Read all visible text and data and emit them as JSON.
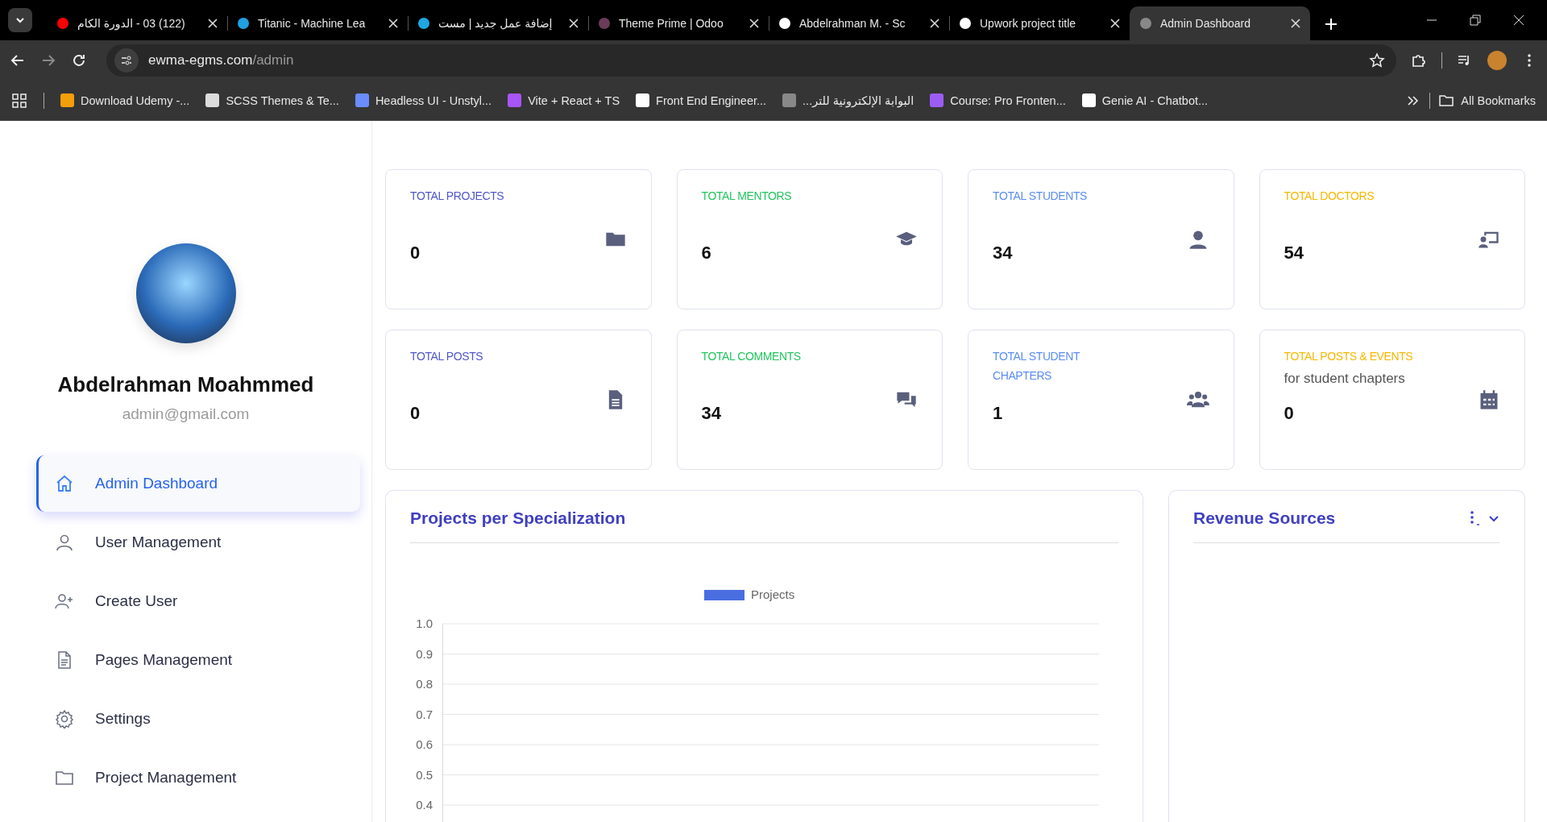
{
  "browser": {
    "tabs": [
      {
        "title": "(122) 03 - الدورة الكام",
        "selected": false
      },
      {
        "title": "Titanic - Machine Lea",
        "selected": false
      },
      {
        "title": "إضافة عمل جديد | مست",
        "selected": false
      },
      {
        "title": "Theme Prime | Odoo",
        "selected": false
      },
      {
        "title": "Abdelrahman M. - Sc",
        "selected": false
      },
      {
        "title": "Upwork project title",
        "selected": false
      },
      {
        "title": "Admin Dashboard",
        "selected": true
      }
    ],
    "url": {
      "host": "ewma-egms.com",
      "path": "/admin"
    },
    "bookmarks": [
      "Download Udemy -...",
      "SCSS Themes & Te...",
      "Headless UI - Unstyl...",
      "Vite + React + TS",
      "Front End Engineer...",
      "البوابة الإلكترونية للتر...",
      "Course: Pro Fronten...",
      "Genie AI - Chatbot..."
    ],
    "all_bookmarks": "All Bookmarks"
  },
  "profile": {
    "name": "Abdelrahman Moahmmed",
    "email": "admin@gmail.com"
  },
  "sidebar": {
    "items": [
      {
        "label": "Admin Dashboard",
        "selected": true
      },
      {
        "label": "User Management",
        "selected": false
      },
      {
        "label": "Create User",
        "selected": false
      },
      {
        "label": "Pages Management",
        "selected": false
      },
      {
        "label": "Settings",
        "selected": false
      },
      {
        "label": "Project Management",
        "selected": false
      }
    ]
  },
  "stats": [
    {
      "label": "TOTAL PROJECTS",
      "value": "0",
      "color": "#4f57c9"
    },
    {
      "label": "TOTAL MENTORS",
      "value": "6",
      "color": "#22c55e"
    },
    {
      "label": "TOTAL STUDENTS",
      "value": "34",
      "color": "#5b8def"
    },
    {
      "label": "TOTAL DOCTORS",
      "value": "54",
      "color": "#f5b800"
    },
    {
      "label": "TOTAL POSTS",
      "value": "0",
      "color": "#4f57c9"
    },
    {
      "label": "TOTAL COMMENTS",
      "value": "34",
      "color": "#22c55e"
    },
    {
      "label": "TOTAL STUDENT CHAPTERS",
      "value": "1",
      "color": "#5b8def"
    },
    {
      "label": "TOTAL POSTS & EVENTS",
      "subtitle": "for student chapters",
      "value": "0",
      "color": "#f5b800"
    }
  ],
  "projects_chart": {
    "title": "Projects per Specialization",
    "chart_data": {
      "type": "bar",
      "grid": true,
      "series": [
        {
          "name": "Projects",
          "color": "#4a6ee0"
        }
      ],
      "ylim": [
        0,
        1
      ],
      "yticks": [
        {
          "value": 1,
          "label": "1.0"
        },
        {
          "value": 0.9,
          "label": "0.9"
        },
        {
          "value": 0.8,
          "label": "0.8"
        },
        {
          "value": 0.7,
          "label": "0.7"
        },
        {
          "value": 0.6,
          "label": "0.6"
        },
        {
          "value": 0.5,
          "label": "0.5"
        },
        {
          "value": 0.4,
          "label": "0.4"
        }
      ]
    }
  },
  "revenue": {
    "title": "Revenue Sources"
  }
}
